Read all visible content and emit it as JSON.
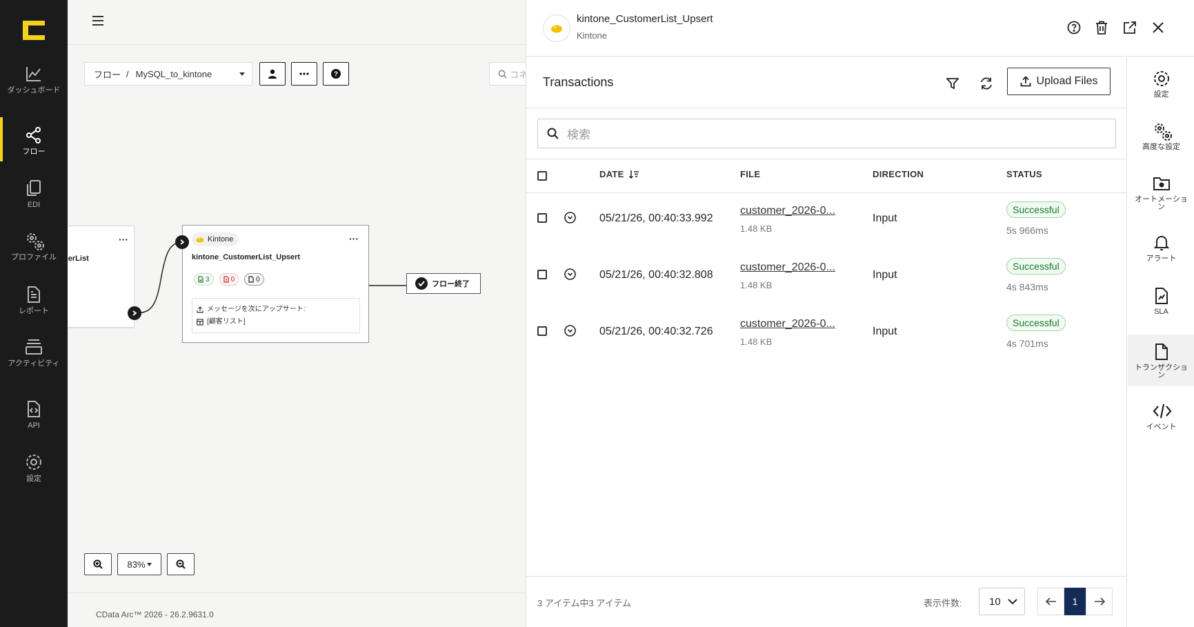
{
  "nav": {
    "items": [
      {
        "label": "ダッシュボード",
        "icon": "chart-icon"
      },
      {
        "label": "フロー",
        "icon": "share-icon"
      },
      {
        "label": "EDI",
        "icon": "copy-icon"
      },
      {
        "label": "プロファイル",
        "icon": "gears-icon"
      },
      {
        "label": "レポート",
        "icon": "file-lines-icon"
      },
      {
        "label": "アクティビティ",
        "icon": "layers-icon"
      },
      {
        "label": "API",
        "icon": "file-code-icon"
      },
      {
        "label": "設定",
        "icon": "gear-icon"
      }
    ],
    "active_index": 1,
    "brand_color": "#f2d21b"
  },
  "canvas": {
    "breadcrumb_root": "フロー",
    "breadcrumb_separator": "/",
    "flow_name": "MySQL_to_kintone",
    "search_placeholder": "コネ",
    "prev_node_label": "merList",
    "node": {
      "chip": "Kintone",
      "title": "kintone_CustomerList_Upsert",
      "count_success": "3",
      "count_error": "0",
      "count_pending": "0",
      "desc_line1": "メッセージを次にアップサート:",
      "desc_line2": "[顧客リスト]"
    },
    "end_node": "フロー終了",
    "zoom": "83%",
    "footer": "CData Arc™ 2026 - 26.2.9631.0"
  },
  "panel": {
    "connector_name": "kintone_CustomerList_Upsert",
    "connector_type": "Kintone",
    "title": "Transactions",
    "upload_label": "Upload Files",
    "search_placeholder": "検索",
    "columns": {
      "date": "DATE",
      "file": "FILE",
      "direction": "DIRECTION",
      "status": "STATUS"
    },
    "rows": [
      {
        "date": "05/21/26, 00:40:33.992",
        "file": "customer_2026-0...",
        "size": "1.48 KB",
        "direction": "Input",
        "status": "Successful",
        "duration": "5s 966ms"
      },
      {
        "date": "05/21/26, 00:40:32.808",
        "file": "customer_2026-0...",
        "size": "1.48 KB",
        "direction": "Input",
        "status": "Successful",
        "duration": "4s 843ms"
      },
      {
        "date": "05/21/26, 00:40:32.726",
        "file": "customer_2026-0...",
        "size": "1.48 KB",
        "direction": "Input",
        "status": "Successful",
        "duration": "4s 701ms"
      }
    ],
    "item_count": "3 アイテム中3 アイテム",
    "per_page_label": "表示件数:",
    "per_page_value": "10",
    "current_page": "1",
    "status_color": "#1e7a31",
    "pager_color": "#142b57"
  },
  "right_sidebar": {
    "items": [
      {
        "label": "設定",
        "icon": "gear-icon"
      },
      {
        "label": "高度な設定",
        "icon": "gears-icon"
      },
      {
        "label": "オートメーション",
        "icon": "folder-gear-icon"
      },
      {
        "label": "アラート",
        "icon": "bell-icon"
      },
      {
        "label": "SLA",
        "icon": "file-sla-icon"
      },
      {
        "label": "トランザクション",
        "icon": "file-icon"
      },
      {
        "label": "イベント",
        "icon": "code-icon"
      }
    ],
    "active_index": 5
  }
}
